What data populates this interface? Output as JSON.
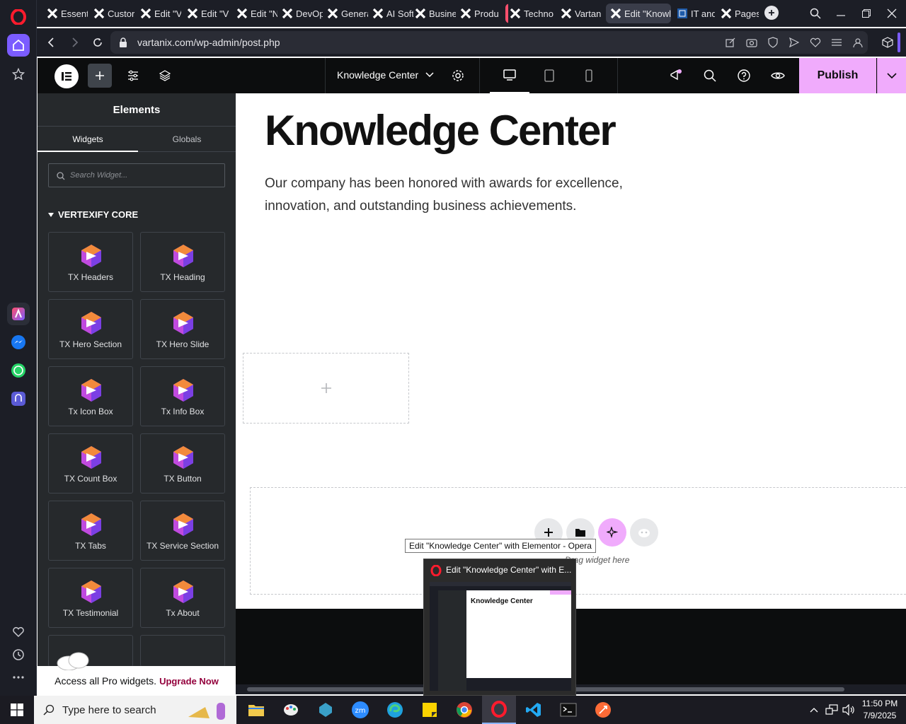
{
  "browser": {
    "tabs": [
      {
        "label": "Essent"
      },
      {
        "label": "Custor"
      },
      {
        "label": "Edit \"V"
      },
      {
        "label": "Edit \"V"
      },
      {
        "label": "Edit \"N"
      },
      {
        "label": "DevOp"
      },
      {
        "label": "Genera"
      },
      {
        "label": "AI Soft"
      },
      {
        "label": "Busine"
      },
      {
        "label": "Produ"
      },
      {
        "label": "Techno"
      },
      {
        "label": "Vartan"
      },
      {
        "label": "Edit \"Knowl"
      },
      {
        "label": "IT and"
      },
      {
        "label": "Pages"
      }
    ],
    "url": "vartanix.com/wp-admin/post.php",
    "tooltip": "Edit \"Knowledge Center\" with Elementor - Opera",
    "preview_title": "Edit \"Knowledge Center\" with E...",
    "preview_heading": "Knowledge Center"
  },
  "editor": {
    "page_name": "Knowledge Center",
    "publish_label": "Publish"
  },
  "panel": {
    "title": "Elements",
    "tabs": [
      "Widgets",
      "Globals"
    ],
    "search_placeholder": "Search Widget...",
    "category": "VERTEXIFY CORE",
    "widgets": [
      "TX Headers",
      "TX Heading",
      "TX Hero Section",
      "TX Hero Slide",
      "Tx Icon Box",
      "Tx Info Box",
      "TX Count Box",
      "TX Button",
      "TX Tabs",
      "TX Service Section",
      "TX Testimonial",
      "Tx About"
    ],
    "promo_text": "Access all Pro widgets.",
    "promo_link": "Upgrade Now"
  },
  "canvas": {
    "heading": "Knowledge Center",
    "paragraph_line1": "Our company has been honored with awards for excellence,",
    "paragraph_line2": "innovation, and outstanding business achievements.",
    "drag_hint": "Drag widget here"
  },
  "taskbar": {
    "search_placeholder": "Type here to search",
    "time": "11:50 PM",
    "date": "7/9/2025"
  },
  "colors": {
    "publish_bg": "#f0abfc",
    "ai_button": "#f0abfc",
    "opera_red": "#ff1b2d",
    "elementor_panel": "#26292c"
  }
}
